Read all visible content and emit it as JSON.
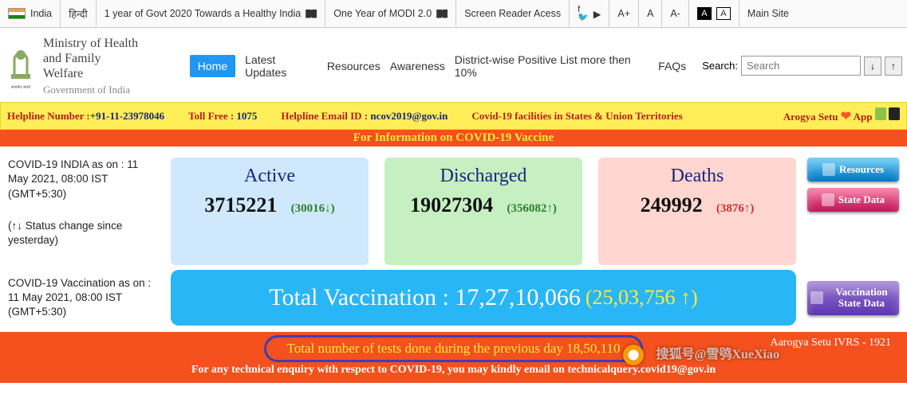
{
  "topbar": {
    "country": "India",
    "hindi": "हिन्दी",
    "gov2020": "1 year of Govt 2020 Towards a Healthy India",
    "modi2": "One Year of MODI 2.0",
    "reader": "Screen Reader Acess",
    "aplus": "A+",
    "a": "A",
    "aminus": "A-",
    "c1": "A",
    "c2": "A",
    "mainsite": "Main Site"
  },
  "ministry": {
    "l1": "Ministry of Health",
    "l2": "and Family Welfare",
    "l3": "Government of India"
  },
  "nav": [
    "Home",
    "Latest Updates",
    "Resources",
    "Awareness",
    "District-wise Positive List more then 10%",
    "FAQs"
  ],
  "search": {
    "label": "Search:",
    "placeholder": "Search"
  },
  "yellow": {
    "helpline_l": "Helpline Number :",
    "helpline_v": "+91-11-23978046",
    "toll_l": "Toll Free :",
    "toll_v": "1075",
    "email_l": "Helpline Email ID :",
    "email_v": "ncov2019@gov.in",
    "facilities": "Covid-19 facilities in States & Union Territories",
    "arogya": "Arogya Setu",
    "app": "App"
  },
  "banner": "For Information on COVID-19 Vaccine",
  "left": {
    "asof": "COVID-19 INDIA as on : 11 May 2021, 08:00 IST (GMT+5:30)",
    "change": "(↑↓ Status change since yesterday)",
    "vacc": "COVID-19 Vaccination as on : 11 May 2021, 08:00 IST (GMT+5:30)"
  },
  "stats": {
    "active": {
      "title": "Active",
      "num": "3715221",
      "delta": "(30016↓)"
    },
    "discharged": {
      "title": "Discharged",
      "num": "19027304",
      "delta": "(356082↑)"
    },
    "deaths": {
      "title": "Deaths",
      "num": "249992",
      "delta": "(3876↑)"
    }
  },
  "buttons": {
    "res": "Resources",
    "state": "State Data",
    "vacc": "Vaccination State Data"
  },
  "vacc_bar": {
    "label": "Total Vaccination : 17,27,10,066",
    "sub": "(25,03,756 ↑)"
  },
  "footer": {
    "tests": "Total number of tests done during the previous day 18,50,110",
    "tech": "For any technical enquiry with respect to COVID-19, you may kindly email on technicalquery.covid19@gov.in",
    "arogya_r": "Aarogya Setu IVRS - 1921"
  },
  "watermark": "搜狐号@雪鸮XueXiao"
}
